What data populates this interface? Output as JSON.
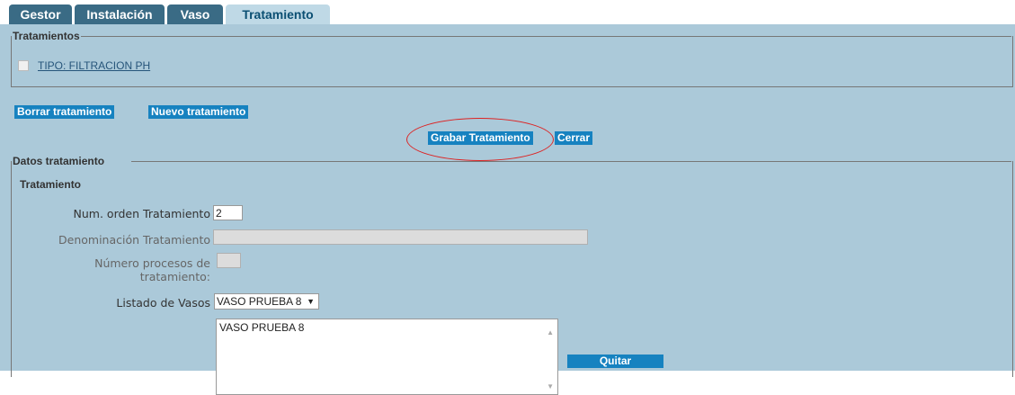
{
  "tabs": [
    {
      "label": "Gestor"
    },
    {
      "label": "Instalación"
    },
    {
      "label": "Vaso"
    },
    {
      "label": "Tratamiento",
      "active": true
    }
  ],
  "tratamientos": {
    "legend": "Tratamientos",
    "items": [
      {
        "label": "TIPO: FILTRACION PH",
        "checked": false
      }
    ]
  },
  "actions": {
    "borrar": "Borrar tratamiento",
    "nuevo": "Nuevo tratamiento",
    "grabar": "Grabar Tratamiento",
    "cerrar": "Cerrar"
  },
  "datos": {
    "legend": "Datos tratamiento",
    "section_title": "Tratamiento",
    "num_orden_label": "Num. orden Tratamiento",
    "num_orden_value": "2",
    "denominacion_label": "Denominación Tratamiento",
    "denominacion_value": "",
    "num_procesos_label_line1": "Número procesos de",
    "num_procesos_label_line2": "tratamiento:",
    "num_procesos_value": "",
    "listado_vasos_label": "Listado de Vasos",
    "listado_vasos_selected": "VASO PRUEBA 8",
    "vasos_list": [
      "VASO PRUEBA 8"
    ],
    "quitar": "Quitar"
  },
  "colors": {
    "panel_bg": "#abc9d9",
    "button_bg": "#1682c0",
    "tab_bg": "#3a6b85",
    "tab_active_bg": "#bfd9e6",
    "highlight_oval": "#dd2222"
  }
}
